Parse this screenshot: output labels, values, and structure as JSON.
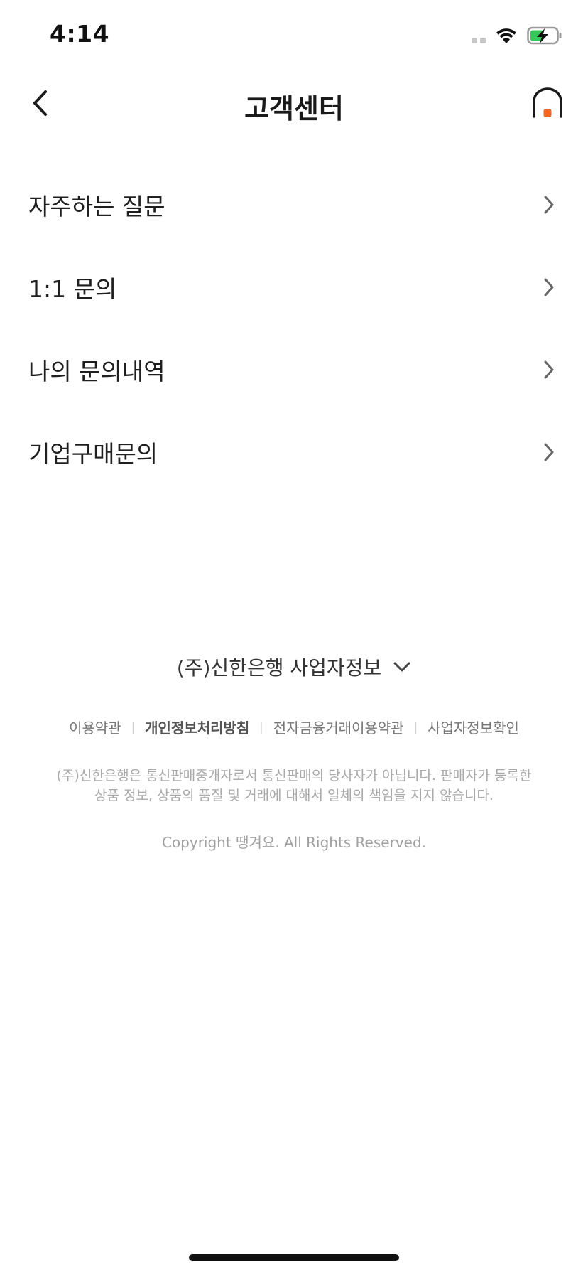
{
  "status_bar": {
    "time": "4:14",
    "icons": [
      "cellular-signal-icon",
      "wifi-icon",
      "battery-charging-icon"
    ]
  },
  "nav": {
    "title": "고객센터",
    "back_icon": "chevron-left-icon",
    "home_icon": "home-icon",
    "accent_color": "#F26522"
  },
  "menu": {
    "items": [
      {
        "label": "자주하는 질문"
      },
      {
        "label": "1:1 문의"
      },
      {
        "label": "나의 문의내역"
      },
      {
        "label": "기업구매문의"
      }
    ]
  },
  "footer": {
    "business_info_label": "(주)신한은행 사업자정보",
    "links": [
      {
        "label": "이용약관"
      },
      {
        "label": "개인정보처리방침"
      },
      {
        "label": "전자금융거래이용약관"
      },
      {
        "label": "사업자정보확인"
      }
    ],
    "disclaimer_line1": "(주)신한은행은 통신판매중개자로서 통신판매의 당사자가 아닙니다. 판매자가 등록한",
    "disclaimer_line2": "상품 정보, 상품의 품질 및 거래에 대해서 일체의 책임을 지지 않습니다.",
    "copyright": "Copyright 땡겨요. All Rights Reserved."
  }
}
